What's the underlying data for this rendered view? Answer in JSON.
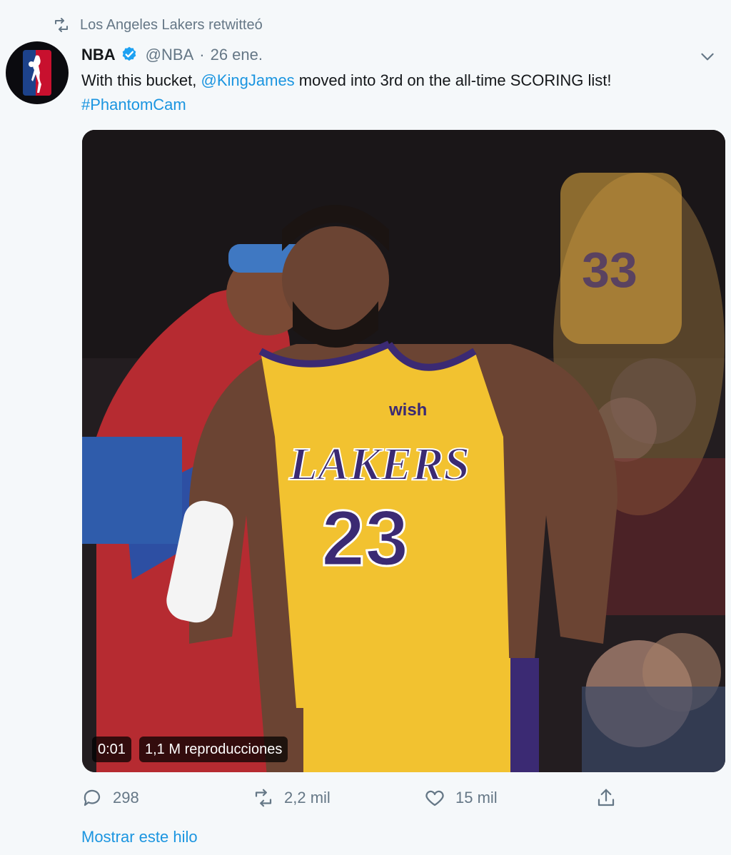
{
  "retweet": {
    "icon": "retweet-icon",
    "text": "Los Angeles Lakers retwitteó"
  },
  "tweet": {
    "author_name": "NBA",
    "handle": "@NBA",
    "separator": "·",
    "date": "26 ene.",
    "text_parts": {
      "before": "With this bucket, ",
      "mention": "@KingJames",
      "after": " moved into 3rd on the all-time SCORING list!",
      "hashtag": "#PhantomCam"
    }
  },
  "media": {
    "jersey_team": "LAKERS",
    "jersey_number": "23",
    "sponsor": "wish",
    "bg_jersey_number": "33",
    "duration": "0:01",
    "views": "1,1 M reproducciones"
  },
  "actions": {
    "reply_count": "298",
    "retweet_count": "2,2 mil",
    "like_count": "15 mil"
  },
  "show_thread": "Mostrar este hilo",
  "colors": {
    "link": "#1b95e0",
    "muted": "#657786",
    "jersey": "#f2c230",
    "purple": "#3b2a73"
  }
}
